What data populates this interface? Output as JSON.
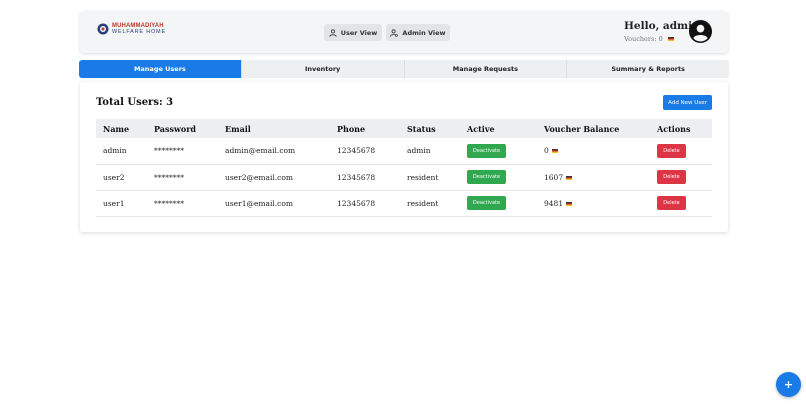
{
  "header": {
    "logo": {
      "line1": "MUHAMMADIYAH",
      "line2": "WELFARE HOME",
      "icon": "logo-mark"
    },
    "user_view_label": "User View",
    "admin_view_label": "Admin View",
    "greeting": "Hello, admin",
    "vouchers_text": "Vouchers: 0"
  },
  "tabs": [
    {
      "label": "Manage Users",
      "active": true
    },
    {
      "label": "Inventory",
      "active": false
    },
    {
      "label": "Manage Requests",
      "active": false
    },
    {
      "label": "Summary & Reports",
      "active": false
    }
  ],
  "users_panel": {
    "total_label": "Total Users: 3",
    "add_button": "Add New User",
    "columns": [
      "Name",
      "Password",
      "Email",
      "Phone",
      "Status",
      "Active",
      "Voucher Balance",
      "Actions"
    ],
    "rows": [
      {
        "name": "admin",
        "password": "********",
        "email": "admin@email.com",
        "phone": "12345678",
        "status": "admin",
        "active_btn": "Deactivate",
        "balance": "0",
        "action_btn": "Delete"
      },
      {
        "name": "user2",
        "password": "********",
        "email": "user2@email.com",
        "phone": "12345678",
        "status": "resident",
        "active_btn": "Deactivate",
        "balance": "1607",
        "action_btn": "Delete"
      },
      {
        "name": "user1",
        "password": "********",
        "email": "user1@email.com",
        "phone": "12345678",
        "status": "resident",
        "active_btn": "Deactivate",
        "balance": "9481",
        "action_btn": "Delete"
      }
    ]
  },
  "fab": {
    "label": "+"
  },
  "colors": {
    "primary": "#1a7ae6",
    "success": "#2fa84f",
    "danger": "#dc3545"
  }
}
